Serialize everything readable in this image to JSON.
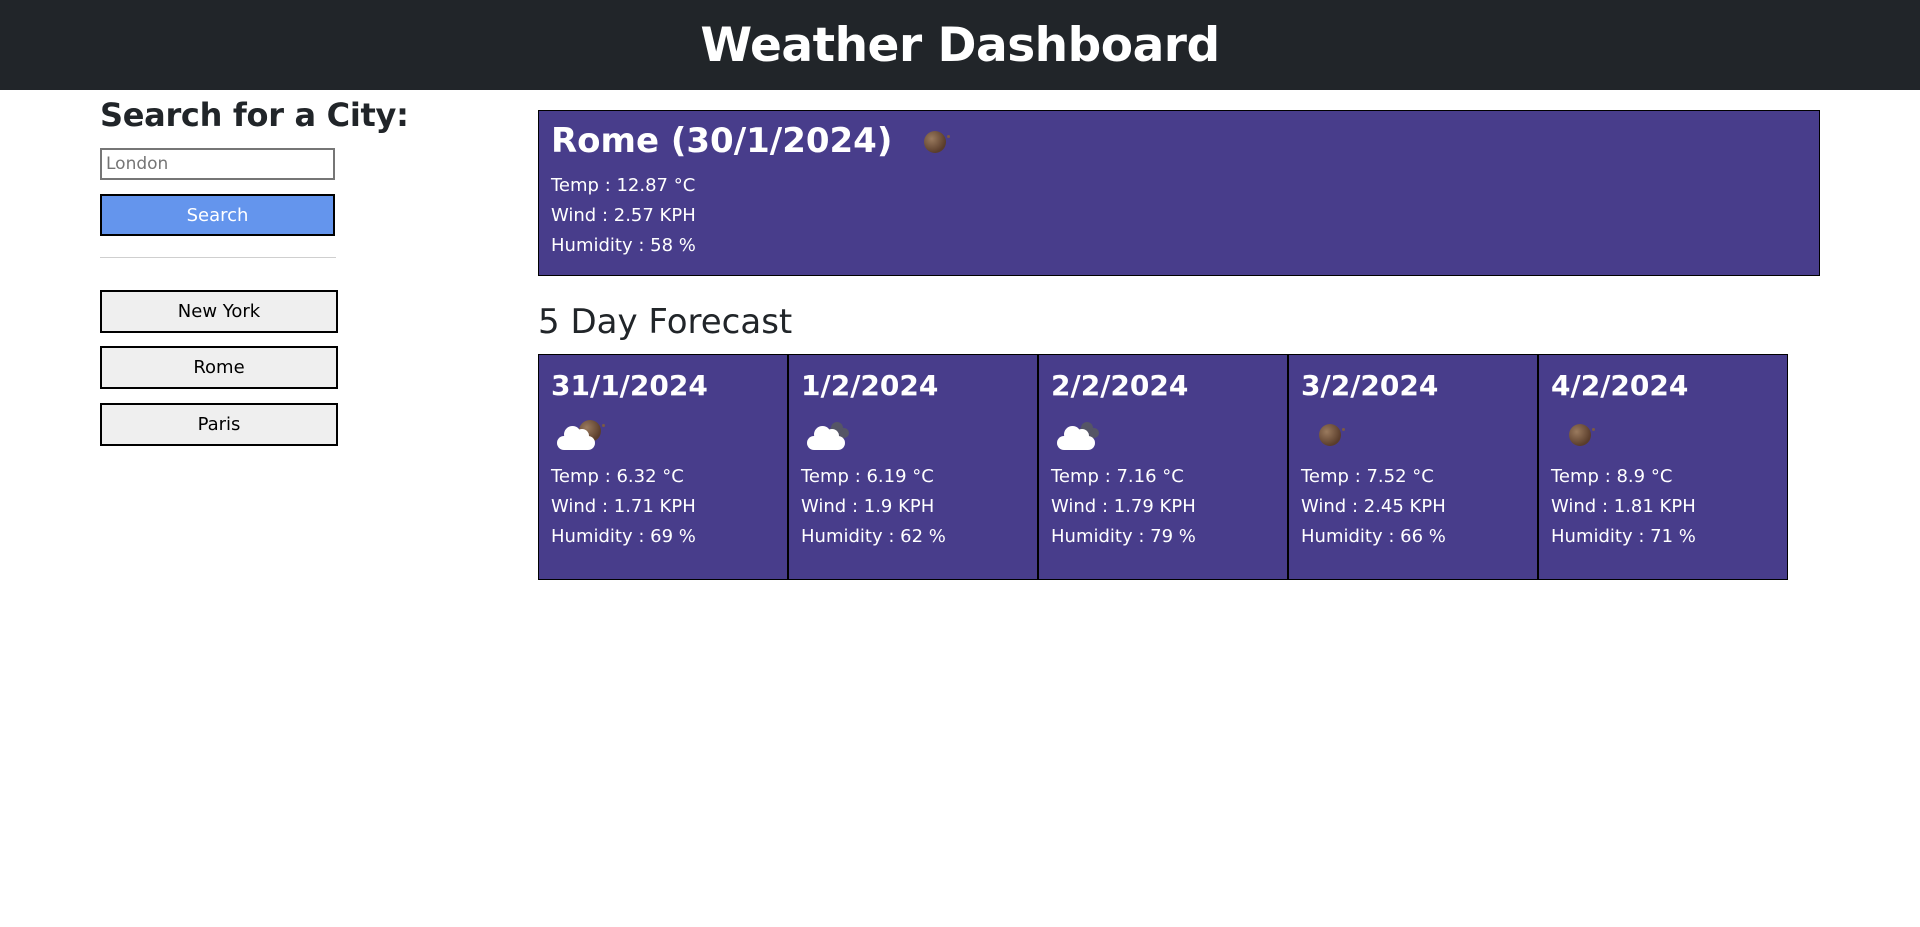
{
  "header": {
    "title": "Weather Dashboard"
  },
  "search": {
    "title": "Search for a City:",
    "placeholder": "London",
    "button_label": "Search"
  },
  "history": [
    {
      "label": "New York"
    },
    {
      "label": "Rome"
    },
    {
      "label": "Paris"
    }
  ],
  "current": {
    "heading": "Rome (30/1/2024)",
    "icon": "moon-icon",
    "temp": "Temp : 12.87 °C",
    "wind": "Wind : 2.57 KPH",
    "humidity": "Humidity : 58 %"
  },
  "forecast": {
    "title": "5 Day Forecast",
    "days": [
      {
        "date": "31/1/2024",
        "icon": "cloud-moon-icon",
        "temp": "Temp : 6.32 °C",
        "wind": "Wind : 1.71 KPH",
        "humidity": "Humidity : 69 %"
      },
      {
        "date": "1/2/2024",
        "icon": "clouds-icon",
        "temp": "Temp : 6.19 °C",
        "wind": "Wind : 1.9 KPH",
        "humidity": "Humidity : 62 %"
      },
      {
        "date": "2/2/2024",
        "icon": "clouds-icon",
        "temp": "Temp : 7.16 °C",
        "wind": "Wind : 1.79 KPH",
        "humidity": "Humidity : 79 %"
      },
      {
        "date": "3/2/2024",
        "icon": "moon-icon",
        "temp": "Temp : 7.52 °C",
        "wind": "Wind : 2.45 KPH",
        "humidity": "Humidity : 66 %"
      },
      {
        "date": "4/2/2024",
        "icon": "moon-icon",
        "temp": "Temp : 8.9 °C",
        "wind": "Wind : 1.81 KPH",
        "humidity": "Humidity : 71 %"
      }
    ]
  },
  "colors": {
    "header_bg": "#212529",
    "card_bg": "#483d8b",
    "search_button": "#6495ed",
    "history_button": "#efefef"
  }
}
